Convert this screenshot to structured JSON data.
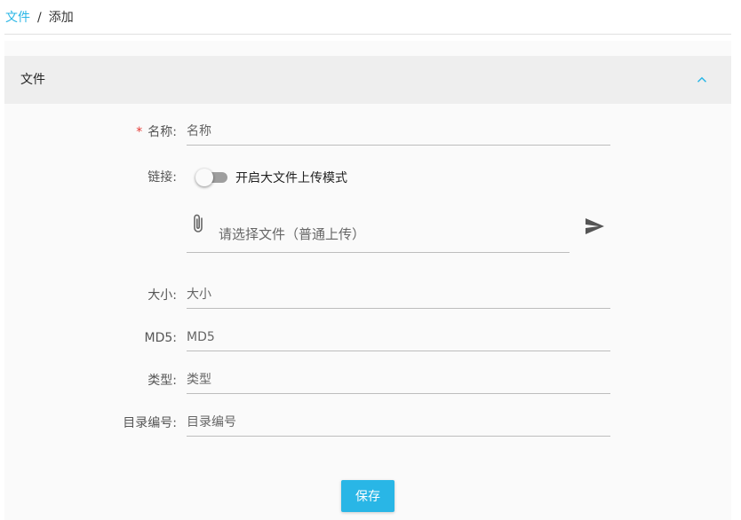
{
  "breadcrumb": {
    "parent": "文件",
    "separator": "/",
    "current": "添加"
  },
  "panel": {
    "title": "文件",
    "collapse_icon": "chevron-up-icon"
  },
  "form": {
    "name": {
      "required_mark": "*",
      "label": "名称:",
      "placeholder": "名称",
      "value": ""
    },
    "link": {
      "label": "链接:",
      "toggle_label": "开启大文件上传模式",
      "toggle_on": false,
      "file_placeholder": "请选择文件（普通上传）",
      "attach_icon": "paperclip-icon",
      "upload_icon": "send-icon"
    },
    "size": {
      "label": "大小:",
      "placeholder": "大小",
      "value": ""
    },
    "md5": {
      "label": "MD5:",
      "placeholder": "MD5",
      "value": ""
    },
    "type": {
      "label": "类型:",
      "placeholder": "类型",
      "value": ""
    },
    "dir_no": {
      "label": "目录编号:",
      "placeholder": "目录编号",
      "value": ""
    },
    "save_label": "保存"
  },
  "colors": {
    "accent": "#29b6e6",
    "required": "#e53935",
    "header_bg": "#eeeeee"
  }
}
